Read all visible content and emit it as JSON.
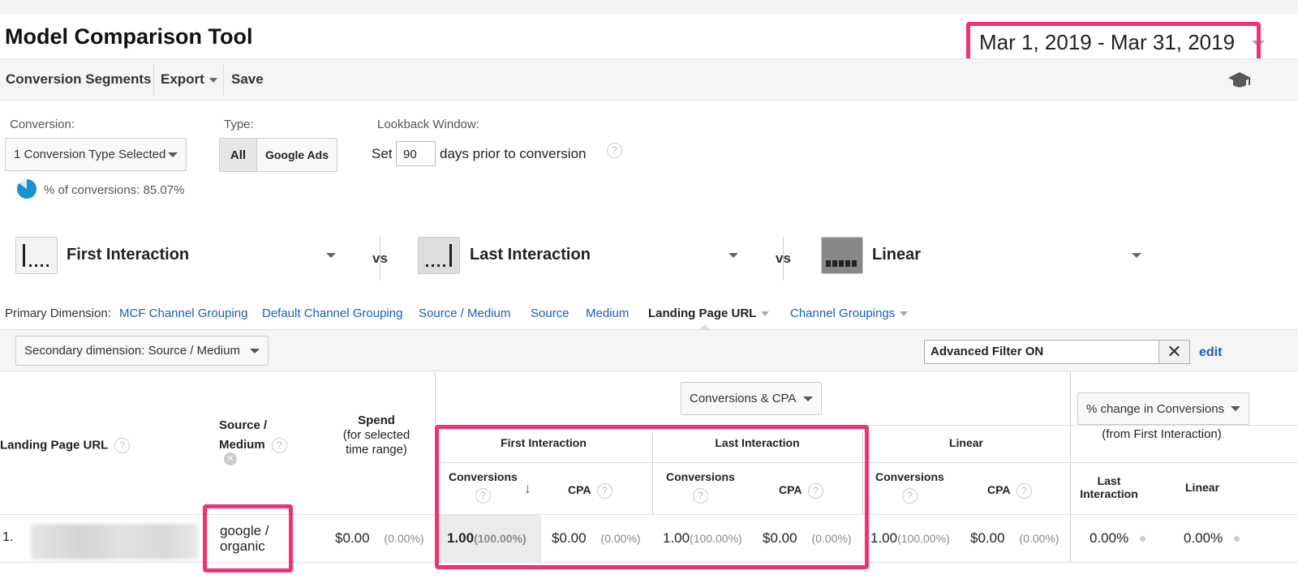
{
  "header": {
    "title": "Model Comparison Tool",
    "date_range": "Mar 1, 2019 - Mar 31, 2019"
  },
  "toolbar": {
    "conversion_segments": "Conversion Segments",
    "export": "Export",
    "save": "Save",
    "help_icon": "graduation-cap-icon"
  },
  "controls": {
    "conversion_label": "Conversion:",
    "conversion_value": "1 Conversion Type Selected",
    "pct_conversions": "% of conversions: 85.07%",
    "pct_conversions_value": 85.07,
    "type_label": "Type:",
    "type_options": [
      "All",
      "Google Ads"
    ],
    "type_selected": "All",
    "lookback_label": "Lookback Window:",
    "lookback_set": "Set",
    "lookback_value": "90",
    "lookback_suffix": "days prior to conversion"
  },
  "models": [
    {
      "name": "First Interaction",
      "icon": "first-interaction-icon"
    },
    {
      "name": "Last Interaction",
      "icon": "last-interaction-icon"
    },
    {
      "name": "Linear",
      "icon": "linear-icon"
    }
  ],
  "vs": "vs",
  "primary_dimension": {
    "label": "Primary Dimension:",
    "options": [
      "MCF Channel Grouping",
      "Default Channel Grouping",
      "Source / Medium",
      "Source",
      "Medium",
      "Landing Page URL",
      "Channel Groupings"
    ],
    "selected": "Landing Page URL"
  },
  "secondary_dimension": "Secondary dimension: Source / Medium",
  "filter": {
    "value": "Advanced Filter ON",
    "edit": "edit"
  },
  "table": {
    "col_landing": "Landing Page URL",
    "col_source_1": "Source /",
    "col_source_2": "Medium",
    "spend_title": "Spend",
    "spend_sub1": "(for selected",
    "spend_sub2": "time range)",
    "metric_select": "Conversions & CPA",
    "change_select": "% change in Conversions",
    "change_sub": "(from First Interaction)",
    "groups": [
      "First Interaction",
      "Last Interaction",
      "Linear"
    ],
    "conversions": "Conversions",
    "cpa": "CPA",
    "change_cols": [
      "Last Interaction",
      "Linear"
    ],
    "rows": [
      {
        "index": "1.",
        "source_medium_1": "google /",
        "source_medium_2": "organic",
        "spend": "$0.00",
        "spend_pct": "(0.00%)",
        "first_conv": "1.00",
        "first_conv_pct": "(100.00%)",
        "first_cpa": "$0.00",
        "first_cpa_pct": "(0.00%)",
        "last_conv": "1.00",
        "last_conv_pct": "(100.00%)",
        "last_cpa": "$0.00",
        "last_cpa_pct": "(0.00%)",
        "linear_conv": "1.00",
        "linear_conv_pct": "(100.00%)",
        "linear_cpa": "$0.00",
        "linear_cpa_pct": "(0.00%)",
        "change_last": "0.00%",
        "change_linear": "0.00%"
      }
    ]
  },
  "colors": {
    "highlight": "#f0326e",
    "link": "#1a5fb4",
    "pie": "#1a8fd1"
  }
}
